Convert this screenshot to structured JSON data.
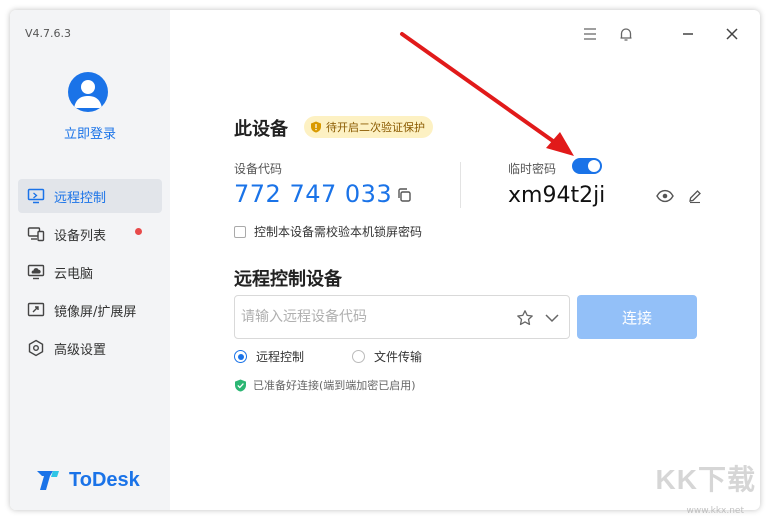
{
  "app": {
    "version": "V4.7.6.3",
    "brand_name": "ToDesk",
    "brand_color": "#1a73e8"
  },
  "sidebar": {
    "login_label": "立即登录",
    "items": [
      {
        "label": "远程控制",
        "icon": "monitor-icon",
        "active": true
      },
      {
        "label": "设备列表",
        "icon": "devices-icon",
        "has_notification_dot": true
      },
      {
        "label": "云电脑",
        "icon": "cloud-pc-icon"
      },
      {
        "label": "镜像屏/扩展屏",
        "icon": "mirror-screen-icon"
      },
      {
        "label": "高级设置",
        "icon": "settings-hex-icon"
      }
    ]
  },
  "titlebar": {
    "icons": [
      "menu-icon",
      "bell-icon",
      "minimize-icon",
      "close-icon"
    ]
  },
  "this_device": {
    "title": "此设备",
    "badge": "待开启二次验证保护",
    "device_code_label": "设备代码",
    "device_code": "772 747 033",
    "temp_password_label": "临时密码",
    "temp_password_enabled": true,
    "temp_password": "xm94t2ji",
    "lock_screen_checkbox_label": "控制本设备需校验本机锁屏密码",
    "lock_screen_checked": false
  },
  "remote": {
    "title": "远程控制设备",
    "input_placeholder": "请输入远程设备代码",
    "input_value": "",
    "connect_label": "连接",
    "modes": [
      {
        "label": "远程控制",
        "selected": true
      },
      {
        "label": "文件传输",
        "selected": false
      }
    ],
    "status": "已准备好连接(端到端加密已启用)"
  },
  "watermark": {
    "text": "KK下载",
    "url": "www.kkx.net"
  }
}
